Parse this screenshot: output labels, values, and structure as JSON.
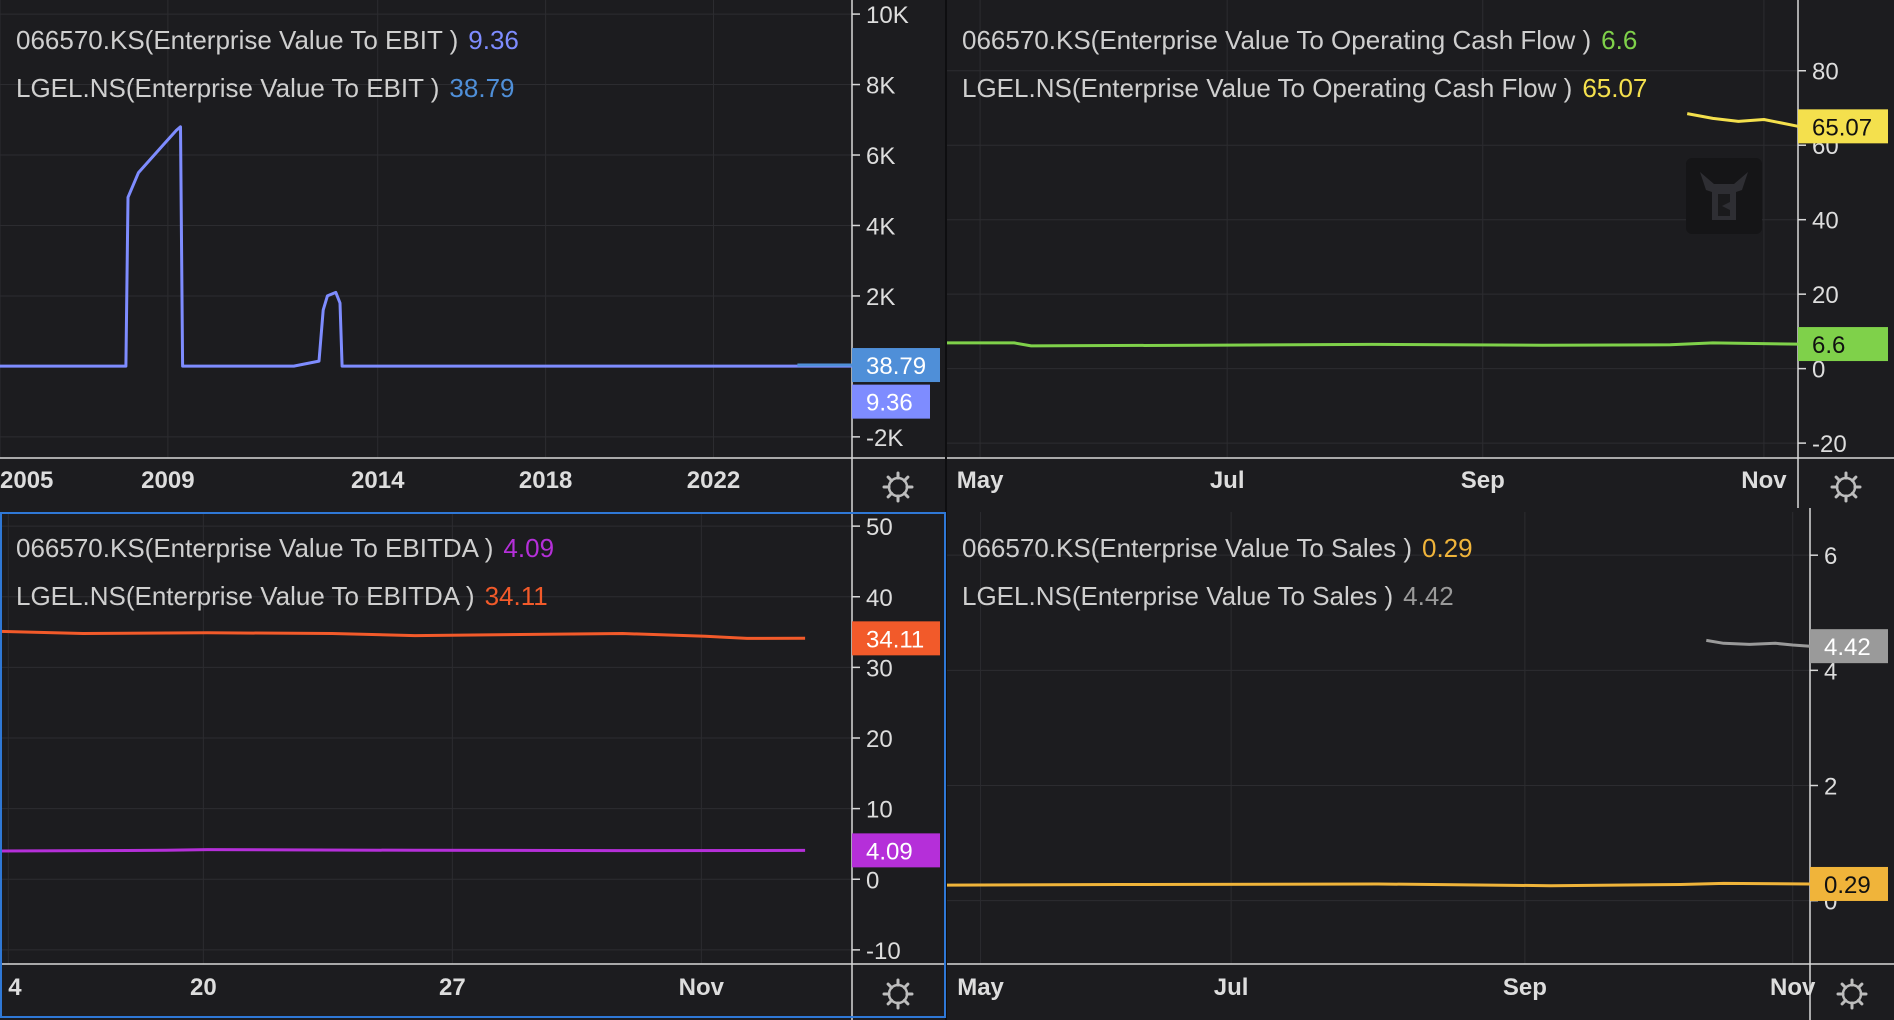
{
  "chart_data": [
    {
      "type": "line",
      "legend": [
        {
          "label": "066570.KS(Enterprise Value To EBIT )",
          "value": "9.36",
          "color": "#7e8cff"
        },
        {
          "label": "LGEL.NS(Enterprise Value To EBIT )",
          "value": "38.79",
          "color": "#4f8fd8"
        }
      ],
      "ylim": [
        -2600,
        10400
      ],
      "y_ticks": [
        "10K",
        "8K",
        "6K",
        "4K",
        "2K",
        "-2K"
      ],
      "y_tick_values": [
        10000,
        8000,
        6000,
        4000,
        2000,
        -2000
      ],
      "x_ticks": [
        "2005",
        "2009",
        "2014",
        "2018",
        "2022"
      ],
      "x_tick_values": [
        2005,
        2009,
        2014,
        2018,
        2022
      ],
      "xlim": [
        2005,
        2025.3
      ],
      "series": [
        {
          "name": "066570.KS(Enterprise Value To EBIT )",
          "color": "#7e8cff",
          "x": [
            2005,
            2008.0,
            2008.05,
            2008.3,
            2008.6,
            2008.9,
            2009.2,
            2009.3,
            2009.35,
            2012.0,
            2012.6,
            2012.7,
            2012.8,
            2013.0,
            2013.1,
            2013.15,
            2025.3
          ],
          "y": [
            9.36,
            9.36,
            4800,
            5500,
            5900,
            6300,
            6700,
            6800,
            9.36,
            9.36,
            150,
            1600,
            2000,
            2100,
            1800,
            9.36,
            9.36
          ]
        },
        {
          "name": "LGEL.NS(Enterprise Value To EBIT )",
          "color": "#4f8fd8",
          "x": [
            2024.0,
            2025.3
          ],
          "y": [
            38.79,
            38.79
          ]
        }
      ],
      "price_labels": [
        {
          "text": "38.79",
          "value": 38.79,
          "bg": "#4f8fd8"
        },
        {
          "text": "9.36",
          "value": -1000,
          "bg": "#7e8cff"
        }
      ]
    },
    {
      "type": "line",
      "legend": [
        {
          "label": "066570.KS(Enterprise Value To Operating Cash Flow )",
          "value": "6.6",
          "color": "#7fd14a"
        },
        {
          "label": "LGEL.NS(Enterprise Value To Operating Cash Flow )",
          "value": "65.07",
          "color": "#f4e04d"
        }
      ],
      "ylim": [
        -24,
        99
      ],
      "y_ticks": [
        "80",
        "60",
        "40",
        "20",
        "0",
        "-20"
      ],
      "y_tick_values": [
        80,
        60,
        40,
        20,
        0,
        -20
      ],
      "x_ticks": [
        "May",
        "Jul",
        "Sep",
        "Nov"
      ],
      "x_tick_values": [
        0.04,
        0.33,
        0.63,
        0.96
      ],
      "xlim": [
        0,
        1
      ],
      "series": [
        {
          "name": "066570.KS(Enterprise Value To Operating Cash Flow )",
          "color": "#7fd14a",
          "x": [
            0,
            0.08,
            0.1,
            0.3,
            0.5,
            0.7,
            0.85,
            0.9,
            1.0
          ],
          "y": [
            6.9,
            6.9,
            6.1,
            6.3,
            6.5,
            6.3,
            6.4,
            6.9,
            6.6
          ]
        },
        {
          "name": "LGEL.NS(Enterprise Value To Operating Cash Flow )",
          "color": "#f4e04d",
          "x": [
            0.87,
            0.9,
            0.93,
            0.96,
            0.98,
            1.0
          ],
          "y": [
            68.5,
            67.2,
            66.4,
            66.9,
            66.0,
            65.07
          ]
        }
      ],
      "price_labels": [
        {
          "text": "65.07",
          "value": 65.07,
          "bg": "#f4e04d"
        },
        {
          "text": "6.6",
          "value": 6.6,
          "bg": "#7fd14a"
        }
      ]
    },
    {
      "type": "line",
      "legend": [
        {
          "label": "066570.KS(Enterprise Value To EBITDA )",
          "value": "4.09",
          "color": "#b52fd9"
        },
        {
          "label": "LGEL.NS(Enterprise Value To EBITDA )",
          "value": "34.11",
          "color": "#f25a2a"
        }
      ],
      "ylim": [
        -12,
        52
      ],
      "y_ticks": [
        "50",
        "40",
        "30",
        "20",
        "10",
        "0",
        "-10"
      ],
      "y_tick_values": [
        50,
        40,
        30,
        20,
        10,
        0,
        -10
      ],
      "x_ticks": [
        "4",
        "20",
        "27",
        "Nov"
      ],
      "x_tick_values": [
        0.01,
        0.245,
        0.545,
        0.845
      ],
      "xlim": [
        0,
        1
      ],
      "series": [
        {
          "name": "066570.KS(Enterprise Value To EBITDA )",
          "color": "#b52fd9",
          "x": [
            0,
            0.2,
            0.25,
            0.5,
            0.75,
            0.97
          ],
          "y": [
            4.0,
            4.1,
            4.2,
            4.1,
            4.05,
            4.09
          ]
        },
        {
          "name": "LGEL.NS(Enterprise Value To EBITDA )",
          "color": "#f25a2a",
          "x": [
            0,
            0.1,
            0.25,
            0.4,
            0.5,
            0.75,
            0.85,
            0.9,
            0.97
          ],
          "y": [
            35.1,
            34.8,
            34.9,
            34.8,
            34.5,
            34.8,
            34.4,
            34.1,
            34.11
          ]
        }
      ],
      "price_labels": [
        {
          "text": "34.11",
          "value": 34.11,
          "bg": "#f25a2a"
        },
        {
          "text": "4.09",
          "value": 4.09,
          "bg": "#b52fd9"
        }
      ]
    },
    {
      "type": "line",
      "legend": [
        {
          "label": "066570.KS(Enterprise Value To Sales )",
          "value": "0.29",
          "color": "#f0b43a"
        },
        {
          "label": "LGEL.NS(Enterprise Value To Sales )",
          "value": "4.42",
          "color": "#9a9a9a"
        }
      ],
      "ylim": [
        -1.1,
        6.75
      ],
      "y_ticks": [
        "6",
        "4",
        "2",
        "0"
      ],
      "y_tick_values": [
        6,
        4,
        2,
        0
      ],
      "x_ticks": [
        "May",
        "Jul",
        "Sep",
        "Nov"
      ],
      "x_tick_values": [
        0.04,
        0.33,
        0.67,
        0.98
      ],
      "xlim": [
        0,
        1
      ],
      "series": [
        {
          "name": "066570.KS(Enterprise Value To Sales )",
          "color": "#f0b43a",
          "x": [
            0,
            0.2,
            0.5,
            0.7,
            0.85,
            0.9,
            1.0
          ],
          "y": [
            0.27,
            0.28,
            0.29,
            0.26,
            0.28,
            0.3,
            0.29
          ]
        },
        {
          "name": "LGEL.NS(Enterprise Value To Sales )",
          "color": "#9a9a9a",
          "x": [
            0.88,
            0.9,
            0.93,
            0.96,
            0.98,
            1.0
          ],
          "y": [
            4.52,
            4.47,
            4.45,
            4.47,
            4.44,
            4.42
          ]
        }
      ],
      "price_labels": [
        {
          "text": "4.42",
          "value": 4.42,
          "bg": "#9a9a9a"
        },
        {
          "text": "0.29",
          "value": 0.29,
          "bg": "#f0b43a"
        }
      ]
    }
  ],
  "colors": {
    "background": "#1c1c1f",
    "grid": "#2c2c30",
    "axis_text": "#dddddd",
    "selected_border": "#2f78d6"
  },
  "icons": {
    "settings": "gear-icon",
    "watermark": "logo-icon"
  }
}
